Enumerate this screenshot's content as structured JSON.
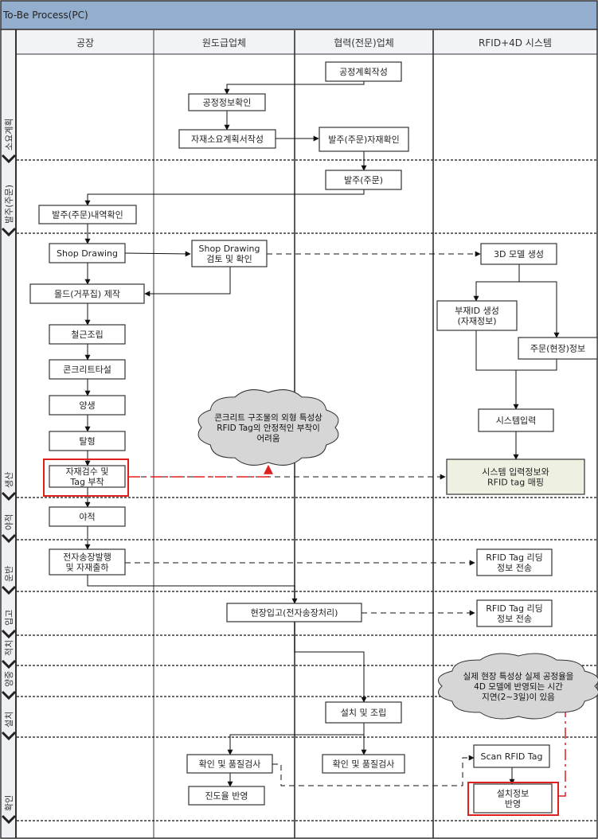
{
  "title": "To-Be Process(PC)",
  "colors": {
    "title_bar": "#94aecd",
    "header_bg": "#f1f3f6",
    "phase_bar_bg": "#eef0f3",
    "border": "#333333",
    "highlight": "#e01f1f",
    "mapping_box_fill": "#eef0e2",
    "cloud_fill": "#d6d6d6"
  },
  "lanes": [
    {
      "id": "factory",
      "label": "공장"
    },
    {
      "id": "general",
      "label": "원도급업체"
    },
    {
      "id": "partner",
      "label": "협력(전문)업체"
    },
    {
      "id": "system",
      "label": "RFID+4D 시스템"
    }
  ],
  "phases": [
    {
      "id": "plan",
      "label": "소요계획"
    },
    {
      "id": "order",
      "label": "발주(주문)"
    },
    {
      "id": "produce",
      "label": "생산"
    },
    {
      "id": "stock",
      "label": "야적"
    },
    {
      "id": "transport",
      "label": "운반"
    },
    {
      "id": "receive",
      "label": "입고"
    },
    {
      "id": "store",
      "label": "적치"
    },
    {
      "id": "lift",
      "label": "양중"
    },
    {
      "id": "install",
      "label": "설치"
    },
    {
      "id": "confirm",
      "label": "확인"
    }
  ],
  "boxes": [
    {
      "id": "b1",
      "lines": [
        "공정계획작성"
      ]
    },
    {
      "id": "b2",
      "lines": [
        "공정정보확인"
      ]
    },
    {
      "id": "b3",
      "lines": [
        "자재소요계획서작성"
      ]
    },
    {
      "id": "b4",
      "lines": [
        "발주(주문)자재확인"
      ]
    },
    {
      "id": "b5",
      "lines": [
        "발주(주문)"
      ]
    },
    {
      "id": "b6",
      "lines": [
        "발주(주문)내역확인"
      ]
    },
    {
      "id": "b7",
      "lines": [
        "Shop Drawing"
      ]
    },
    {
      "id": "b8",
      "lines": [
        "Shop Drawing",
        "검토 및 확인"
      ]
    },
    {
      "id": "b9",
      "lines": [
        "3D 모델 생성"
      ]
    },
    {
      "id": "b10",
      "lines": [
        "몰드(거푸집) 제작"
      ]
    },
    {
      "id": "b11",
      "lines": [
        "부재ID 생성",
        "(자재정보)"
      ]
    },
    {
      "id": "b12",
      "lines": [
        "주문(현장)정보"
      ]
    },
    {
      "id": "b13",
      "lines": [
        "철근조립"
      ]
    },
    {
      "id": "b14",
      "lines": [
        "콘크리트타설"
      ]
    },
    {
      "id": "b15",
      "lines": [
        "양생"
      ]
    },
    {
      "id": "b16",
      "lines": [
        "시스템입력"
      ]
    },
    {
      "id": "b17",
      "lines": [
        "탈형"
      ]
    },
    {
      "id": "b18",
      "lines": [
        "자재검수 및",
        "Tag 부착"
      ]
    },
    {
      "id": "b19",
      "lines": [
        "시스템 입력정보와",
        "RFID tag 매핑"
      ]
    },
    {
      "id": "b20",
      "lines": [
        "야적"
      ]
    },
    {
      "id": "b21",
      "lines": [
        "전자송장발행",
        "및 자재출하"
      ]
    },
    {
      "id": "b22",
      "lines": [
        "RFID Tag 리딩",
        "정보 전송"
      ]
    },
    {
      "id": "b23",
      "lines": [
        "현장입고(전자송장처리)"
      ]
    },
    {
      "id": "b24",
      "lines": [
        "RFID Tag 리딩",
        "정보 전송"
      ]
    },
    {
      "id": "b25",
      "lines": [
        "설치 및 조립"
      ]
    },
    {
      "id": "b26",
      "lines": [
        "확인 및 품질검사"
      ]
    },
    {
      "id": "b27",
      "lines": [
        "확인 및 품질검사"
      ]
    },
    {
      "id": "b28",
      "lines": [
        "Scan RFID Tag"
      ]
    },
    {
      "id": "b29",
      "lines": [
        "진도율 반영"
      ]
    },
    {
      "id": "b30",
      "lines": [
        "설치정보",
        "반영"
      ]
    }
  ],
  "clouds": [
    {
      "id": "c1",
      "lines": [
        "콘크리트 구조물의 외형 특성상",
        "RFID Tag의 안정적인 부착이",
        "어려움"
      ]
    },
    {
      "id": "c2",
      "lines": [
        "실제 현장 특성상 실제 공정율을",
        "4D 모델에 반영되는 시간",
        "지연(2~3일)이 있음"
      ]
    }
  ]
}
